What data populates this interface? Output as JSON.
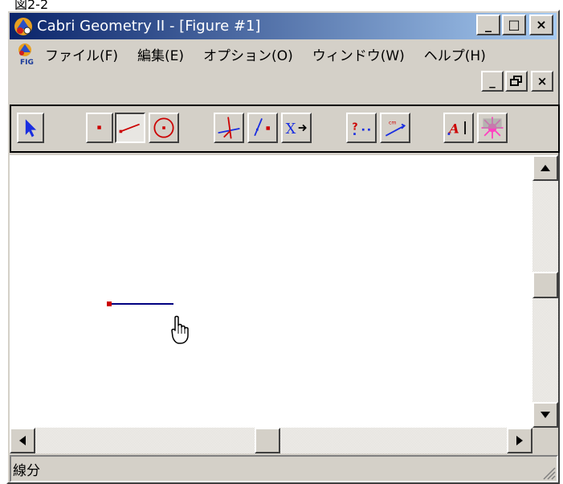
{
  "caption": "図2-2",
  "window": {
    "title": "Cabri Geometry II - [Figure #1]",
    "caption_buttons": {
      "minimize": "_",
      "maximize": "□",
      "close": "×"
    },
    "mdi_buttons": {
      "minimize": "_",
      "restore": "🗗",
      "close": "×"
    }
  },
  "menu": {
    "items": [
      {
        "label": "ファイル(F)"
      },
      {
        "label": "編集(E)"
      },
      {
        "label": "オプション(O)"
      },
      {
        "label": "ウィンドウ(W)"
      },
      {
        "label": "ヘルプ(H)"
      }
    ]
  },
  "toolbar": {
    "tools": [
      {
        "name": "pointer-tool",
        "icon": "arrow-pointer-icon",
        "active": false
      },
      {
        "name": "point-tool",
        "icon": "point-icon",
        "active": false
      },
      {
        "name": "segment-tool",
        "icon": "segment-icon",
        "active": true
      },
      {
        "name": "circle-tool",
        "icon": "circle-icon",
        "active": false
      },
      {
        "name": "perpendicular-tool",
        "icon": "perpendicular-icon",
        "active": false
      },
      {
        "name": "symmetry-tool",
        "icon": "symmetry-icon",
        "active": false
      },
      {
        "name": "transform-tool",
        "icon": "transform-icon",
        "active": false
      },
      {
        "name": "check-property-tool",
        "icon": "check-property-icon",
        "active": false
      },
      {
        "name": "measure-tool",
        "icon": "measure-icon",
        "active": false
      },
      {
        "name": "label-tool",
        "icon": "label-icon",
        "active": false
      },
      {
        "name": "display-tool",
        "icon": "display-icon",
        "active": false
      }
    ]
  },
  "status": {
    "text": "線分"
  },
  "colors": {
    "title_start": "#0a246a",
    "title_end": "#a6caf0",
    "segment": "#000080",
    "point": "#cc0000",
    "face": "#d4d0c8"
  }
}
